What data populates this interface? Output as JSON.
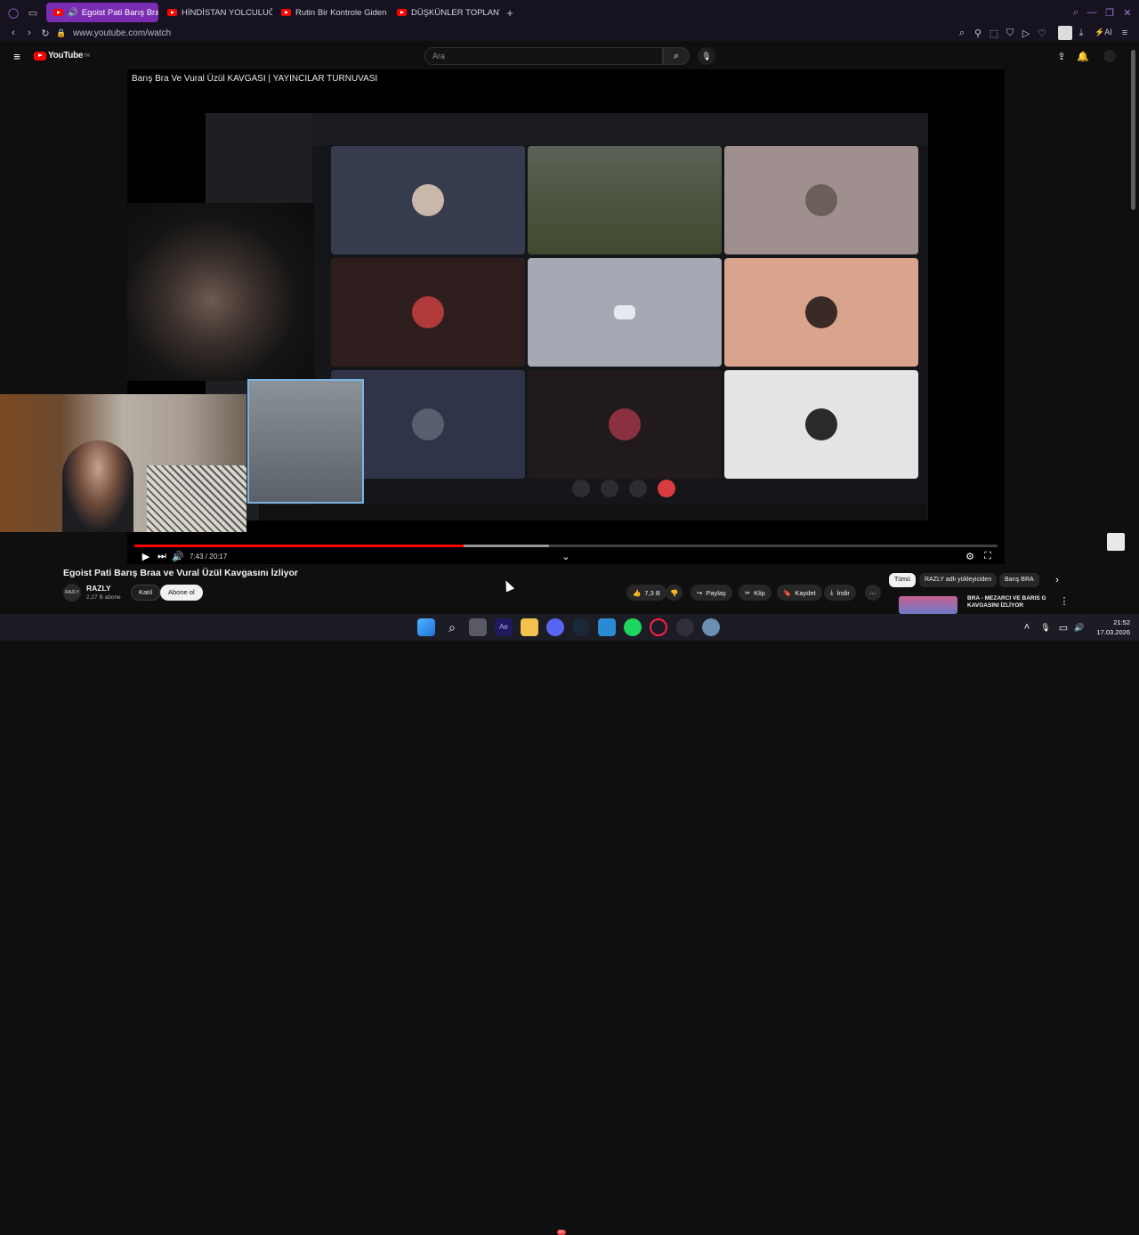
{
  "browser": {
    "tabs": [
      {
        "title": "Egoist Pati Barış Braa v",
        "active": true
      },
      {
        "title": "HİNDİSTAN YOLCULUĞU",
        "active": false
      },
      {
        "title": "Rutin Bir Kontrole Giden P",
        "active": false
      },
      {
        "title": "DÜŞKÜNLER TOPLANTISI",
        "active": false
      }
    ],
    "new_tab_label": "+",
    "url": "www.youtube.com/watch",
    "ai_label": "AI",
    "accent": "#7a2db2"
  },
  "youtube": {
    "logo_text": "YouTube",
    "logo_sup": "TR",
    "search_placeholder": "Ara"
  },
  "player": {
    "overlay_title": "Barış Bra Ve Vural Üzül KAVGASI | YAYINCILAR TURNUVASI",
    "time_current": "7:43",
    "time_total": "20:17",
    "time_sep": " / ",
    "progress": 0.381,
    "buffered": 0.48
  },
  "video": {
    "title": "Egoist Pati Barış Braa ve Vural Üzül Kavgasını İzliyor",
    "channel": "RAZLY",
    "channel_avatar_text": "RAZLY",
    "subscribers": "2,27 B abone",
    "join_label": "Katıl",
    "subscribe_label": "Abone ol",
    "likes": "7,3 B",
    "share_label": "Paylaş",
    "clip_label": "Klip",
    "save_label": "Kaydet",
    "download_label": "İndir"
  },
  "sidebar": {
    "chips": [
      {
        "label": "Tümü",
        "selected": true
      },
      {
        "label": "RAZLY adlı yükleyiciden",
        "selected": false
      },
      {
        "label": "Barış BRA",
        "selected": false
      }
    ],
    "recommendation_title": "BRA - MEZARCI VE BARIS G KAVGASINI İZLİYOR"
  },
  "taskbar": {
    "time": "21:52",
    "date": "17.03.2026",
    "discord_badge": "9+"
  }
}
